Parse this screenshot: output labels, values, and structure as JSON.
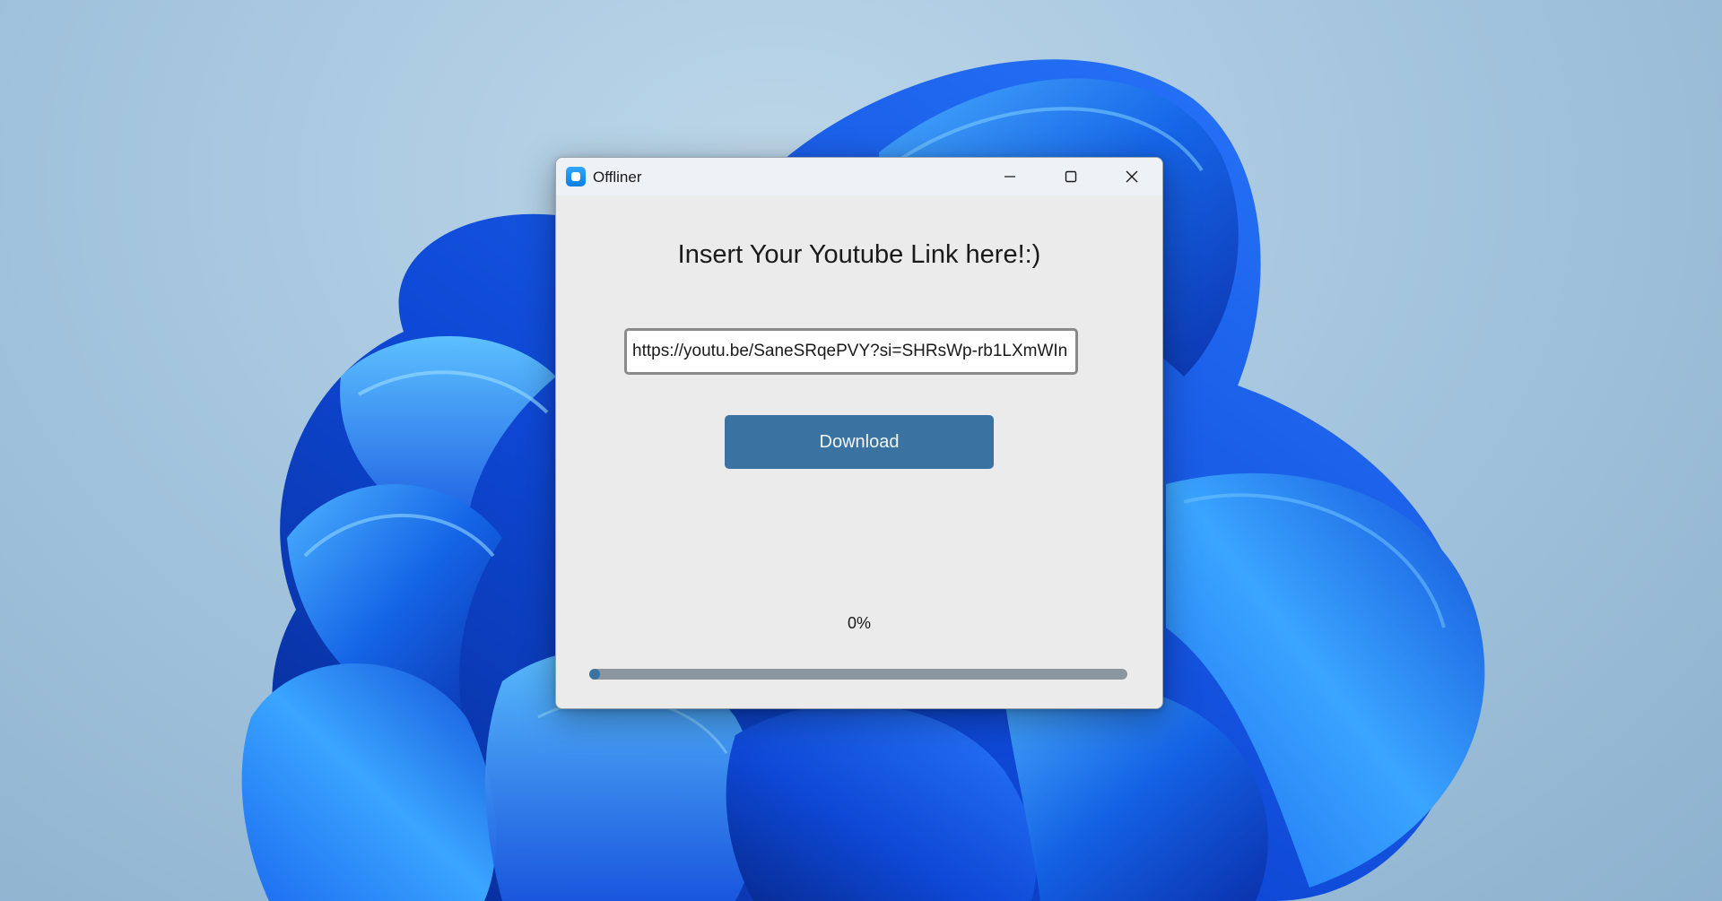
{
  "window": {
    "title": "Offliner",
    "app_icon": "offliner-app-icon",
    "controls": {
      "minimize_icon": "minimize-icon",
      "maximize_icon": "maximize-icon",
      "close_icon": "close-icon"
    }
  },
  "main": {
    "heading": "Insert Your Youtube Link here!:)",
    "url_input": {
      "value": "https://youtu.be/SaneSRqePVY?si=SHRsWp-rb1LXmWIn",
      "placeholder": ""
    },
    "download_label": "Download",
    "progress": {
      "label": "0%",
      "value": 0
    }
  },
  "colors": {
    "accent": "#3a73a2",
    "track": "#8b96a1",
    "window_bg": "#ebebeb"
  }
}
